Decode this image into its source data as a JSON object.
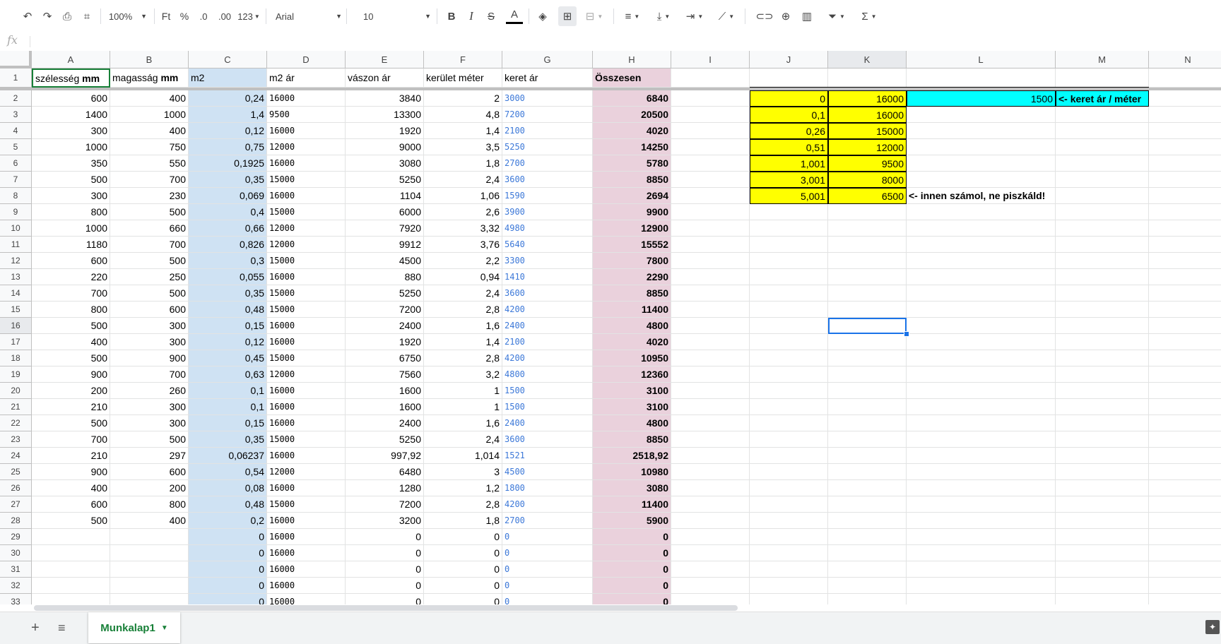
{
  "toolbar": {
    "zoom": "100%",
    "currency": "Ft",
    "percent": "%",
    "dec_decrease": ".0",
    "dec_increase": ".00",
    "more_formats": "123",
    "font": "Arial",
    "font_size": "10",
    "bold": "B",
    "italic": "I",
    "strike": "S",
    "text_color": "A",
    "sum": "Σ"
  },
  "formula_bar": {
    "icon": "fx",
    "value": ""
  },
  "columns": [
    "A",
    "B",
    "C",
    "D",
    "E",
    "F",
    "G",
    "H",
    "I",
    "J",
    "K",
    "L",
    "M",
    "N"
  ],
  "selected_col": "K",
  "rows": [
    "1",
    "2",
    "3",
    "4",
    "5",
    "6",
    "7",
    "8",
    "9",
    "10",
    "11",
    "12",
    "13",
    "14",
    "15",
    "16",
    "17",
    "18",
    "19",
    "20",
    "21",
    "22",
    "23",
    "24",
    "25",
    "26",
    "27",
    "28",
    "29",
    "30",
    "31",
    "32",
    "33"
  ],
  "selected_row": "16",
  "header_row": {
    "a_prefix": "szélesség ",
    "a_bold": "mm",
    "b_prefix": "magasság ",
    "b_bold": "mm",
    "c": "m2",
    "d": "m2 ár",
    "e": "vászon ár",
    "f": "kerület méter",
    "g": "keret ár",
    "h": "Összesen"
  },
  "data": [
    [
      "600",
      "400",
      "0,24",
      "16000",
      "3840",
      "2",
      "3000",
      "6840"
    ],
    [
      "1400",
      "1000",
      "1,4",
      "9500",
      "13300",
      "4,8",
      "7200",
      "20500"
    ],
    [
      "300",
      "400",
      "0,12",
      "16000",
      "1920",
      "1,4",
      "2100",
      "4020"
    ],
    [
      "1000",
      "750",
      "0,75",
      "12000",
      "9000",
      "3,5",
      "5250",
      "14250"
    ],
    [
      "350",
      "550",
      "0,1925",
      "16000",
      "3080",
      "1,8",
      "2700",
      "5780"
    ],
    [
      "500",
      "700",
      "0,35",
      "15000",
      "5250",
      "2,4",
      "3600",
      "8850"
    ],
    [
      "300",
      "230",
      "0,069",
      "16000",
      "1104",
      "1,06",
      "1590",
      "2694"
    ],
    [
      "800",
      "500",
      "0,4",
      "15000",
      "6000",
      "2,6",
      "3900",
      "9900"
    ],
    [
      "1000",
      "660",
      "0,66",
      "12000",
      "7920",
      "3,32",
      "4980",
      "12900"
    ],
    [
      "1180",
      "700",
      "0,826",
      "12000",
      "9912",
      "3,76",
      "5640",
      "15552"
    ],
    [
      "600",
      "500",
      "0,3",
      "15000",
      "4500",
      "2,2",
      "3300",
      "7800"
    ],
    [
      "220",
      "250",
      "0,055",
      "16000",
      "880",
      "0,94",
      "1410",
      "2290"
    ],
    [
      "700",
      "500",
      "0,35",
      "15000",
      "5250",
      "2,4",
      "3600",
      "8850"
    ],
    [
      "800",
      "600",
      "0,48",
      "15000",
      "7200",
      "2,8",
      "4200",
      "11400"
    ],
    [
      "500",
      "300",
      "0,15",
      "16000",
      "2400",
      "1,6",
      "2400",
      "4800"
    ],
    [
      "400",
      "300",
      "0,12",
      "16000",
      "1920",
      "1,4",
      "2100",
      "4020"
    ],
    [
      "500",
      "900",
      "0,45",
      "15000",
      "6750",
      "2,8",
      "4200",
      "10950"
    ],
    [
      "900",
      "700",
      "0,63",
      "12000",
      "7560",
      "3,2",
      "4800",
      "12360"
    ],
    [
      "200",
      "260",
      "0,1",
      "16000",
      "1600",
      "1",
      "1500",
      "3100"
    ],
    [
      "210",
      "300",
      "0,1",
      "16000",
      "1600",
      "1",
      "1500",
      "3100"
    ],
    [
      "500",
      "300",
      "0,15",
      "16000",
      "2400",
      "1,6",
      "2400",
      "4800"
    ],
    [
      "700",
      "500",
      "0,35",
      "15000",
      "5250",
      "2,4",
      "3600",
      "8850"
    ],
    [
      "210",
      "297",
      "0,06237",
      "16000",
      "997,92",
      "1,014",
      "1521",
      "2518,92"
    ],
    [
      "900",
      "600",
      "0,54",
      "12000",
      "6480",
      "3",
      "4500",
      "10980"
    ],
    [
      "400",
      "200",
      "0,08",
      "16000",
      "1280",
      "1,2",
      "1800",
      "3080"
    ],
    [
      "600",
      "800",
      "0,48",
      "15000",
      "7200",
      "2,8",
      "4200",
      "11400"
    ],
    [
      "500",
      "400",
      "0,2",
      "16000",
      "3200",
      "1,8",
      "2700",
      "5900"
    ],
    [
      "",
      "",
      "0",
      "16000",
      "0",
      "0",
      "0",
      "0"
    ],
    [
      "",
      "",
      "0",
      "16000",
      "0",
      "0",
      "0",
      "0"
    ],
    [
      "",
      "",
      "0",
      "16000",
      "0",
      "0",
      "0",
      "0"
    ],
    [
      "",
      "",
      "0",
      "16000",
      "0",
      "0",
      "0",
      "0"
    ],
    [
      "",
      "",
      "0",
      "16000",
      "0",
      "0",
      "0",
      "0"
    ]
  ],
  "lookup": [
    [
      "0",
      "16000"
    ],
    [
      "0,1",
      "16000"
    ],
    [
      "0,26",
      "15000"
    ],
    [
      "0,51",
      "12000"
    ],
    [
      "1,001",
      "9500"
    ],
    [
      "3,001",
      "8000"
    ],
    [
      "5,001",
      "6500"
    ]
  ],
  "lookup_note": "<- innen számol, ne piszkáld!",
  "frame_price": {
    "value": "1500",
    "label": "<- keret ár / méter"
  },
  "sheet_tab": {
    "name": "Munkalap1"
  },
  "colors": {
    "m2_col": "#cfe2f3",
    "total_col": "#ead1dc",
    "lookup": "#ffff00",
    "frame_price": "#00ffff",
    "accent": "#1a73e8",
    "tab": "#188038"
  }
}
